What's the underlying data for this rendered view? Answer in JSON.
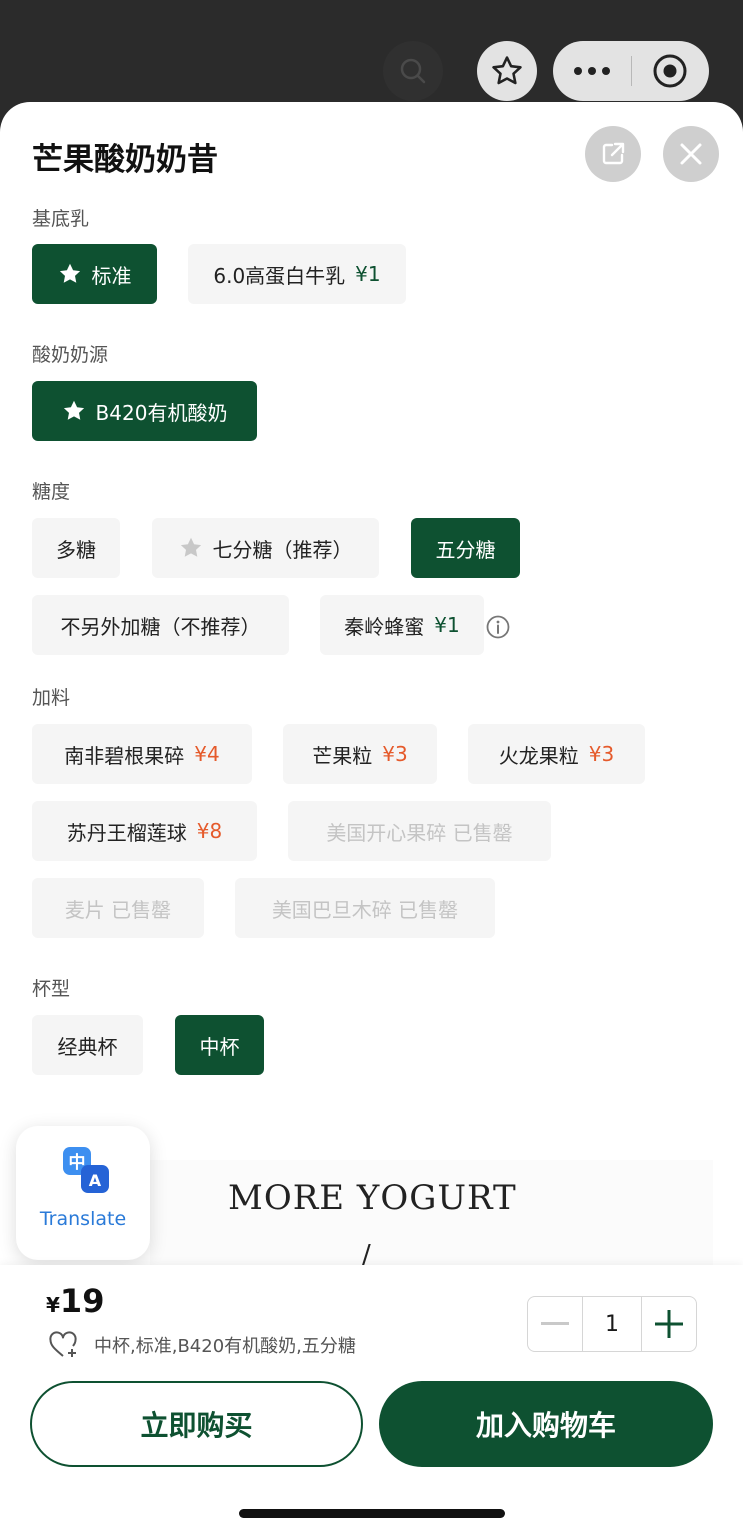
{
  "product": {
    "title": "芒果酸奶奶昔"
  },
  "sections": {
    "base_milk": {
      "label": "基底乳",
      "options": [
        {
          "label": "标准",
          "price": ""
        },
        {
          "label": "6.0高蛋白牛乳",
          "price": "¥1"
        }
      ]
    },
    "yogurt_source": {
      "label": "酸奶奶源",
      "options": [
        {
          "label": "B420有机酸奶"
        }
      ]
    },
    "sweetness": {
      "label": "糖度",
      "options": [
        {
          "label": "多糖"
        },
        {
          "label": "七分糖（推荐）"
        },
        {
          "label": "五分糖"
        },
        {
          "label": "不另外加糖（不推荐）"
        },
        {
          "label": "秦岭蜂蜜",
          "price": "¥1"
        }
      ]
    },
    "toppings": {
      "label": "加料",
      "options": [
        {
          "label": "南非碧根果碎",
          "price": "¥4"
        },
        {
          "label": "芒果粒",
          "price": "¥3"
        },
        {
          "label": "火龙果粒",
          "price": "¥3"
        },
        {
          "label": "苏丹王榴莲球",
          "price": "¥8"
        },
        {
          "label": "美国开心果碎 已售罄"
        },
        {
          "label": "麦片 已售罄"
        },
        {
          "label": "美国巴旦木碎 已售罄"
        }
      ]
    },
    "cup": {
      "label": "杯型",
      "options": [
        {
          "label": "经典杯"
        },
        {
          "label": "中杯"
        }
      ]
    }
  },
  "poster": {
    "text": "MORE YOGURT",
    "mark": "/"
  },
  "translate": {
    "label": "Translate",
    "glyph_top": "中",
    "glyph_bottom": "A"
  },
  "footer": {
    "currency": "¥",
    "price": "19",
    "summary": "中杯,标准,B420有机酸奶,五分糖",
    "quantity": "1",
    "buy_now": "立即购买",
    "add_to_cart": "加入购物车"
  },
  "colors": {
    "brand_green": "#0e5131",
    "price_red": "#e55a2b",
    "translate_blue": "#2a7ad8"
  },
  "icons": [
    "search-icon",
    "star-icon",
    "more-icon",
    "target-icon",
    "share-icon",
    "close-icon",
    "info-icon",
    "heart-plus-icon",
    "minus-icon",
    "plus-icon",
    "translate-icon"
  ]
}
